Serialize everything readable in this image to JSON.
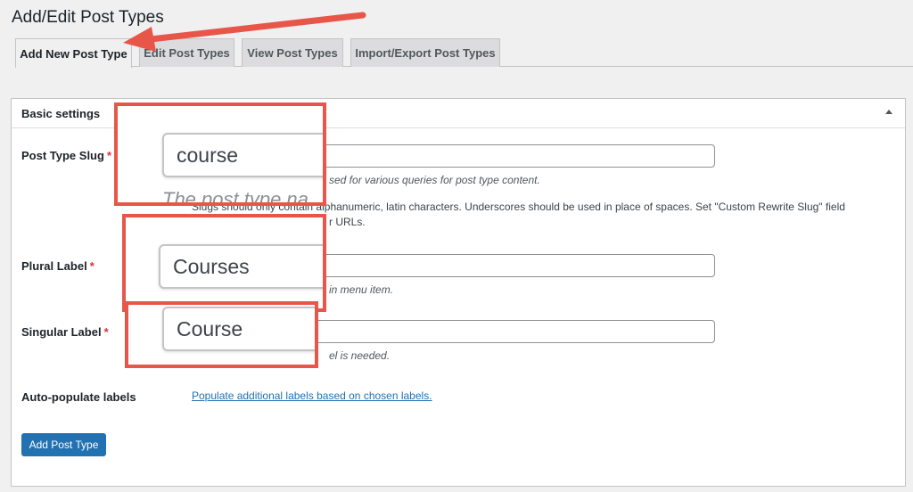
{
  "page": {
    "title": "Add/Edit Post Types"
  },
  "tabs": [
    {
      "label": "Add New Post Type",
      "active": true
    },
    {
      "label": "Edit Post Types",
      "active": false
    },
    {
      "label": "View Post Types",
      "active": false
    },
    {
      "label": "Import/Export Post Types",
      "active": false
    }
  ],
  "panel": {
    "title": "Basic settings",
    "fields": {
      "slug": {
        "label": "Post Type Slug",
        "required_mark": "*",
        "value": "",
        "zoom_value": "course",
        "zoom_ghost": "The post type na",
        "desc": "sed for various queries for post type content.",
        "note": "Slugs should only contain alphanumeric, latin characters. Underscores should be used in place of spaces. Set \"Custom Rewrite Slug\" field",
        "note2": "r URLs."
      },
      "plural": {
        "label": "Plural Label",
        "required_mark": "*",
        "value": "",
        "zoom_value": "Courses",
        "desc": "in menu item."
      },
      "singular": {
        "label": "Singular Label",
        "required_mark": "*",
        "value": "",
        "zoom_value": "Course",
        "desc": "el is needed."
      }
    },
    "auto_populate": {
      "label": "Auto-populate labels",
      "link": "Populate additional labels based on chosen labels."
    },
    "submit_label": "Add Post Type"
  },
  "colors": {
    "accent": "#2271b1",
    "annotation": "#e8564a",
    "required": "#d63638"
  }
}
